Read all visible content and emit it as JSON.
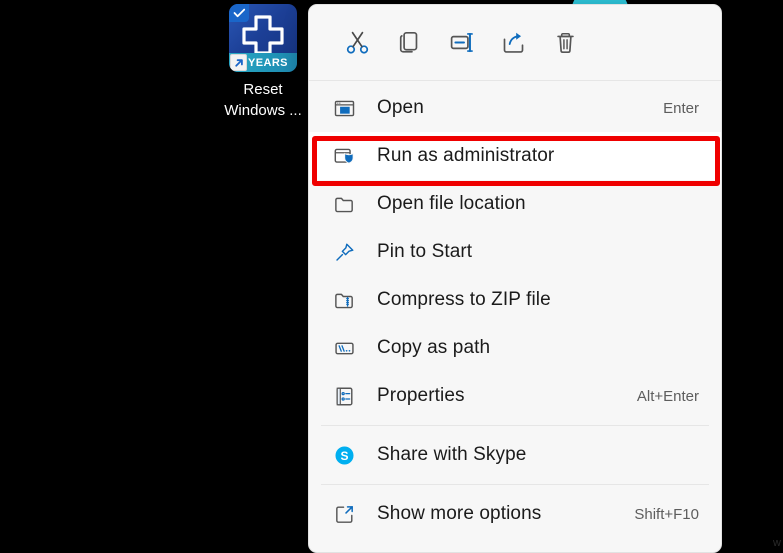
{
  "desktop": {
    "shortcut": {
      "icon_name": "reset-windows-update-tool-icon",
      "badge_text": "YEARS",
      "label_line1": "Reset",
      "label_line2": "Windows ...",
      "selected": true
    },
    "background_color": "#000000",
    "bubble_color": "#2ec4d8",
    "watermark": "w"
  },
  "context_menu": {
    "background_color": "#f7f7f7",
    "toolbar": [
      {
        "name": "cut-icon",
        "label": "Cut"
      },
      {
        "name": "copy-icon",
        "label": "Copy"
      },
      {
        "name": "rename-icon",
        "label": "Rename"
      },
      {
        "name": "share-icon",
        "label": "Share"
      },
      {
        "name": "delete-icon",
        "label": "Delete"
      }
    ],
    "items": [
      {
        "id": "open",
        "icon": "open-window-icon",
        "label": "Open",
        "accel": "Enter",
        "highlighted": false
      },
      {
        "id": "run-as-administrator",
        "icon": "shield-window-icon",
        "label": "Run as administrator",
        "accel": "",
        "highlighted": true
      },
      {
        "id": "open-file-location",
        "icon": "folder-icon",
        "label": "Open file location",
        "accel": "",
        "highlighted": false
      },
      {
        "id": "pin-to-start",
        "icon": "pin-icon",
        "label": "Pin to Start",
        "accel": "",
        "highlighted": false
      },
      {
        "id": "compress-to-zip-file",
        "icon": "zip-folder-icon",
        "label": "Compress to ZIP file",
        "accel": "",
        "highlighted": false
      },
      {
        "id": "copy-as-path",
        "icon": "path-icon",
        "label": "Copy as path",
        "accel": "",
        "highlighted": false
      },
      {
        "id": "properties",
        "icon": "properties-icon",
        "label": "Properties",
        "accel": "Alt+Enter",
        "highlighted": false
      }
    ],
    "share_item": {
      "id": "share-with-skype",
      "icon": "skype-icon",
      "label": "Share with Skype",
      "accel": ""
    },
    "more_item": {
      "id": "show-more-options",
      "icon": "expand-icon",
      "label": "Show more options",
      "accel": "Shift+F10"
    },
    "highlight_color": "#ef0000",
    "accent_color": "#0f6cbd",
    "skype_color": "#00aff0"
  }
}
